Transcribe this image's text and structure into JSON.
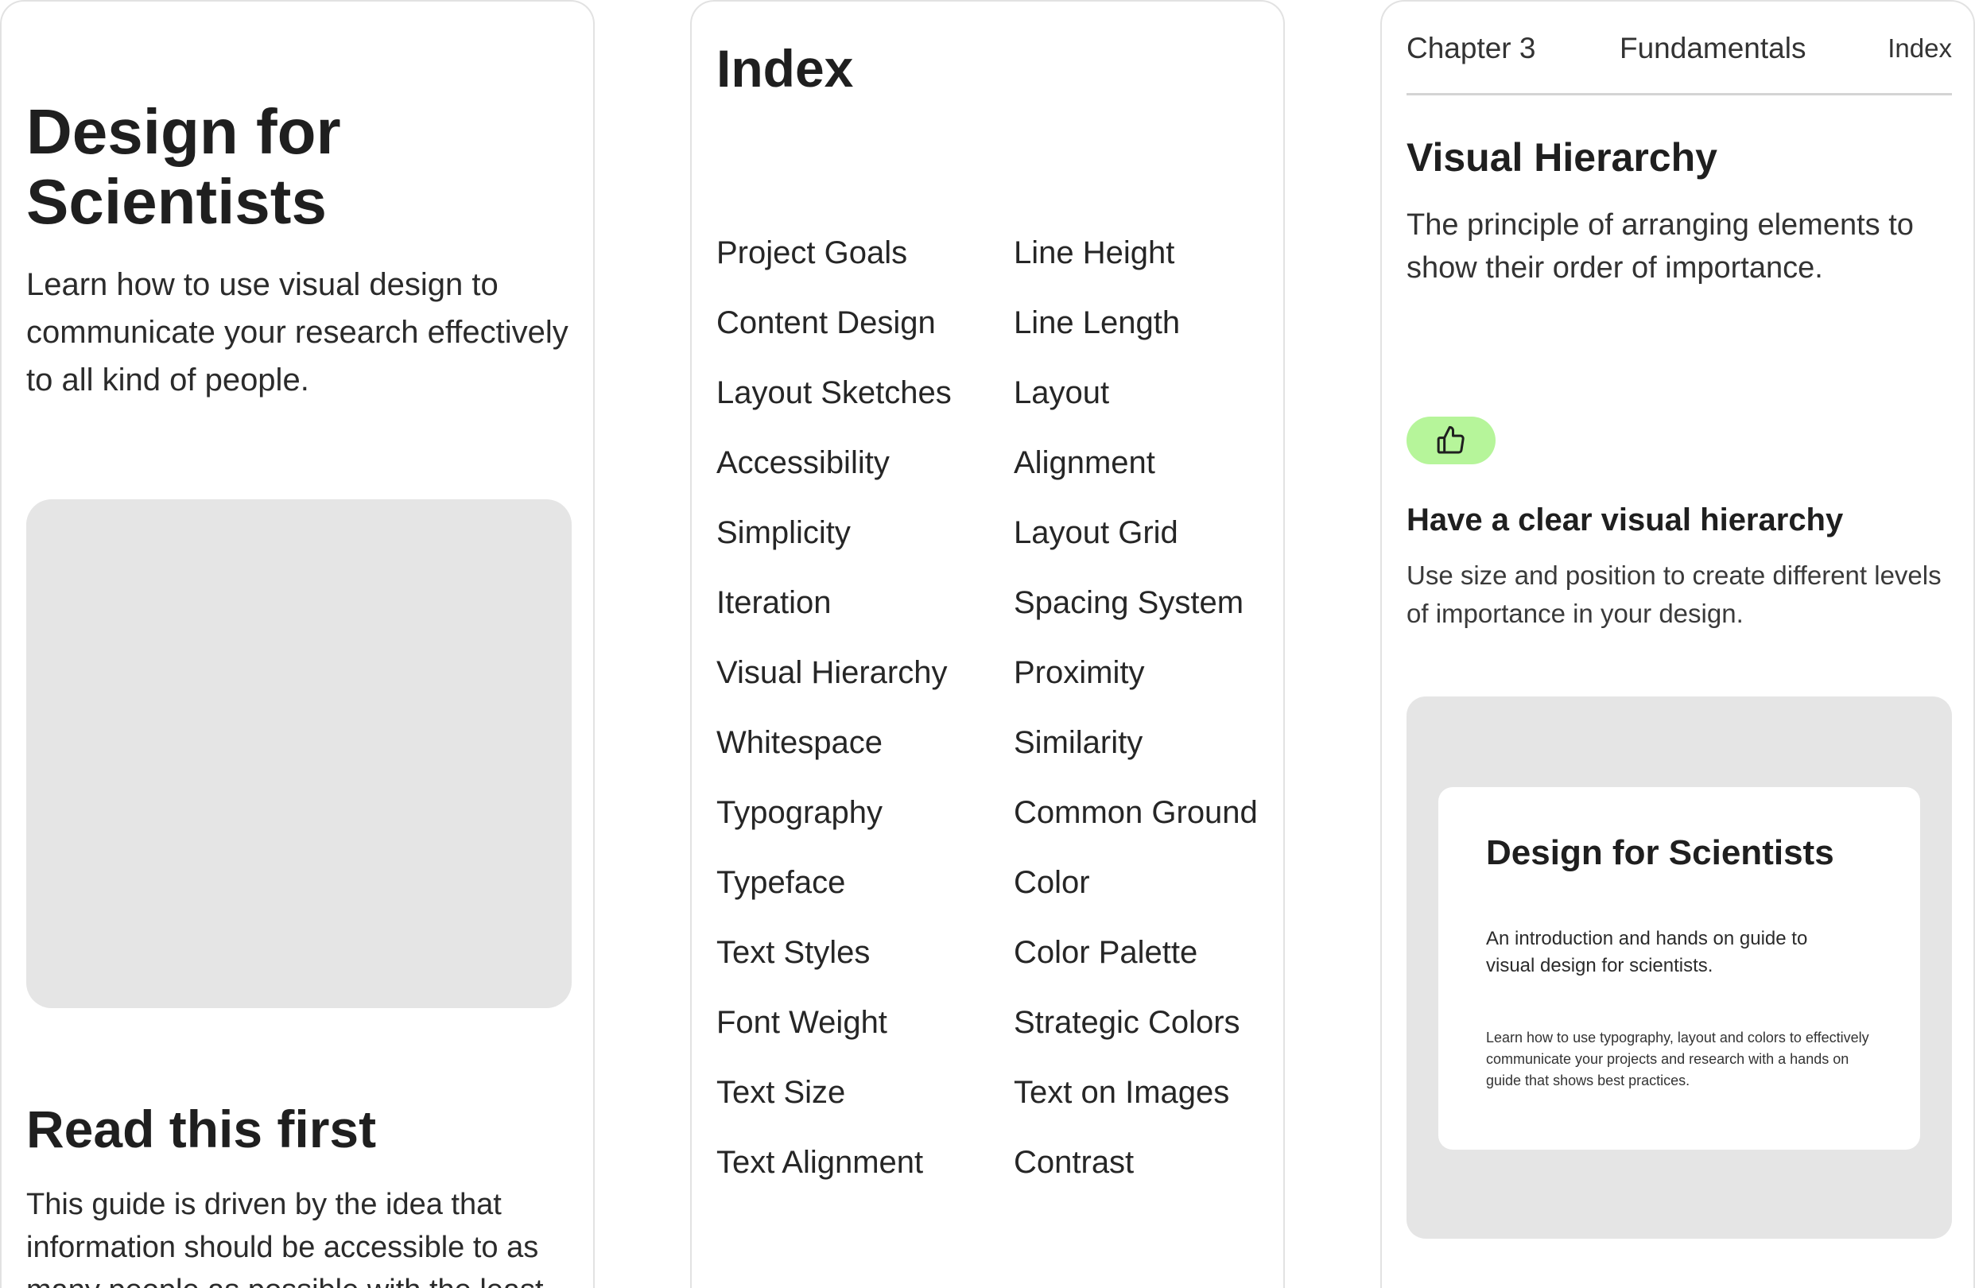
{
  "card1": {
    "title": "Design for Scientists",
    "description": "Learn how to use visual design to communicate your research effectively to all kind of people.",
    "section_heading": "Read this first",
    "section_body": "This guide is driven by the idea that information should be accessible to as many people as possible with the least"
  },
  "card2": {
    "title": "Index",
    "left_items": [
      "Project Goals",
      "Content Design",
      "Layout Sketches",
      "Accessibility",
      "Simplicity",
      "Iteration",
      "Visual Hierarchy",
      "Whitespace",
      "Typography",
      "Typeface",
      "Text Styles",
      "Font Weight",
      "Text Size",
      "Text Alignment"
    ],
    "right_items": [
      "Line Height",
      "Line Length",
      "Layout",
      "Alignment",
      "Layout Grid",
      "Spacing System",
      "Proximity",
      "Similarity",
      "Common Ground",
      "Color",
      "Color Palette",
      "Strategic Colors",
      "Text on Images",
      "Contrast"
    ]
  },
  "card3": {
    "nav": {
      "chapter": "Chapter 3",
      "section": "Fundamentals",
      "index_link": "Index"
    },
    "title": "Visual Hierarchy",
    "description": "The principle of arranging elements to show their order of importance.",
    "badge_icon": "thumbs-up-icon",
    "badge_color": "#b6f59a",
    "tip_heading": "Have a clear visual hierarchy",
    "tip_body": "Use size and position to create different levels of importance in your design.",
    "preview": {
      "title": "Design for Scientists",
      "subtitle": "An introduction and hands on guide to visual design for scientists.",
      "small_text": "Learn how to use typography, layout and colors to effectively communicate your projects and research with a hands on guide that shows best practices."
    }
  }
}
